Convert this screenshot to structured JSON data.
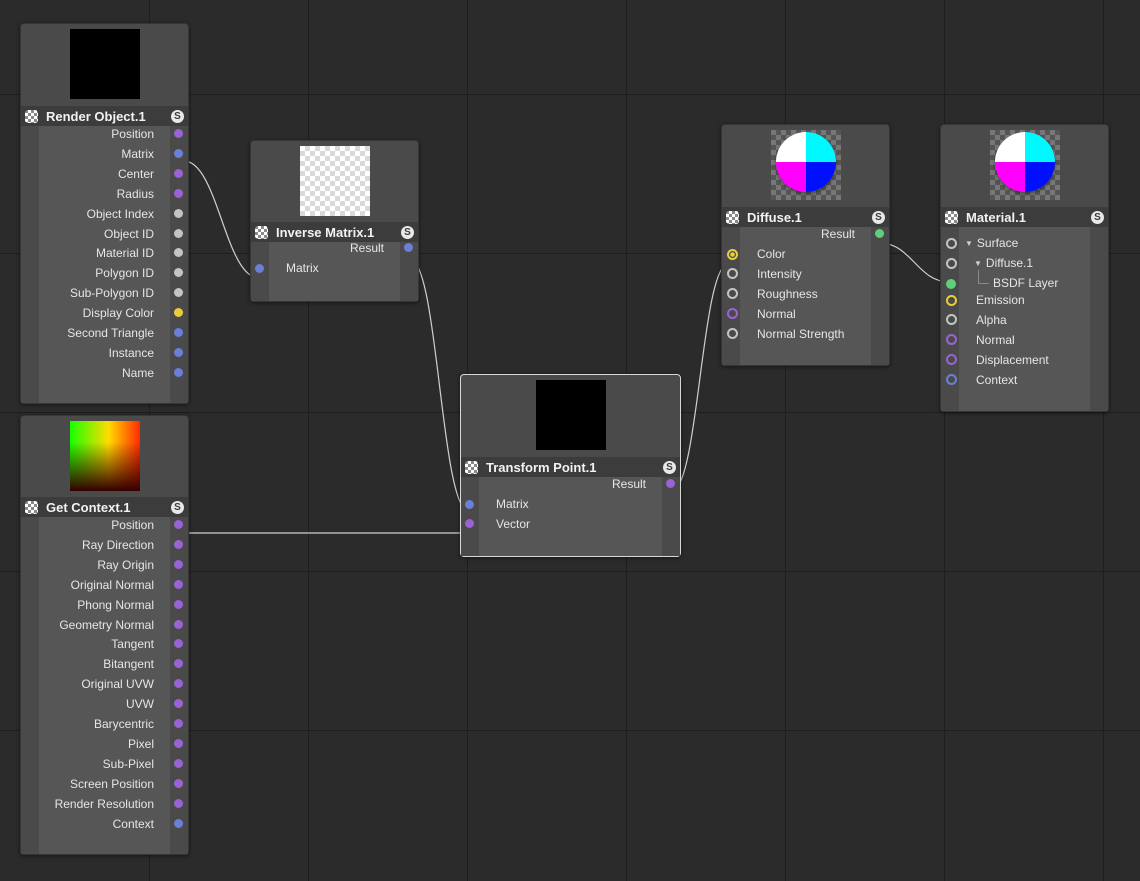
{
  "colors": {
    "purple": "#9a62d4",
    "blue": "#6a7fd8",
    "gray": "#c4c4c4",
    "yellow": "#e8cf3a",
    "green": "#5fcf7a",
    "wire": "#cfcfcf"
  },
  "nodes": {
    "render_object": {
      "title": "Render Object.1",
      "preview": "black",
      "outputs": [
        {
          "label": "Position",
          "type": "purple"
        },
        {
          "label": "Matrix",
          "type": "blue"
        },
        {
          "label": "Center",
          "type": "purple"
        },
        {
          "label": "Radius",
          "type": "purple"
        },
        {
          "label": "Object Index",
          "type": "gray"
        },
        {
          "label": "Object ID",
          "type": "gray"
        },
        {
          "label": "Material ID",
          "type": "gray"
        },
        {
          "label": "Polygon ID",
          "type": "gray"
        },
        {
          "label": "Sub-Polygon ID",
          "type": "gray"
        },
        {
          "label": "Display Color",
          "type": "yellow"
        },
        {
          "label": "Second Triangle",
          "type": "blue"
        },
        {
          "label": "Instance",
          "type": "blue"
        },
        {
          "label": "Name",
          "type": "blue"
        }
      ]
    },
    "get_context": {
      "title": "Get Context.1",
      "preview": "gradient",
      "outputs": [
        {
          "label": "Position",
          "type": "purple"
        },
        {
          "label": "Ray Direction",
          "type": "purple"
        },
        {
          "label": "Ray Origin",
          "type": "purple"
        },
        {
          "label": "Original Normal",
          "type": "purple"
        },
        {
          "label": "Phong Normal",
          "type": "purple"
        },
        {
          "label": "Geometry Normal",
          "type": "purple"
        },
        {
          "label": "Tangent",
          "type": "purple"
        },
        {
          "label": "Bitangent",
          "type": "purple"
        },
        {
          "label": "Original UVW",
          "type": "purple"
        },
        {
          "label": "UVW",
          "type": "purple"
        },
        {
          "label": "Barycentric",
          "type": "purple"
        },
        {
          "label": "Pixel",
          "type": "purple"
        },
        {
          "label": "Sub-Pixel",
          "type": "purple"
        },
        {
          "label": "Screen Position",
          "type": "purple"
        },
        {
          "label": "Render Resolution",
          "type": "purple"
        },
        {
          "label": "Context",
          "type": "blue"
        }
      ]
    },
    "inverse_matrix": {
      "title": "Inverse Matrix.1",
      "preview": "checker",
      "outputs": [
        {
          "label": "Result",
          "type": "blue"
        }
      ],
      "inputs": [
        {
          "label": "Matrix",
          "type": "blue"
        }
      ]
    },
    "transform_point": {
      "title": "Transform Point.1",
      "preview": "black",
      "outputs": [
        {
          "label": "Result",
          "type": "purple"
        }
      ],
      "inputs": [
        {
          "label": "Matrix",
          "type": "blue"
        },
        {
          "label": "Vector",
          "type": "purple"
        }
      ]
    },
    "diffuse": {
      "title": "Diffuse.1",
      "preview": "sphere",
      "outputs": [
        {
          "label": "Result",
          "type": "green"
        }
      ],
      "inputs": [
        {
          "label": "Color",
          "type": "yellow"
        },
        {
          "label": "Intensity",
          "type": "gray"
        },
        {
          "label": "Roughness",
          "type": "gray"
        },
        {
          "label": "Normal",
          "type": "purple"
        },
        {
          "label": "Normal Strength",
          "type": "gray"
        }
      ]
    },
    "material": {
      "title": "Material.1",
      "preview": "sphere",
      "tree": [
        {
          "label": "Surface",
          "expanded": true
        },
        {
          "label": "Diffuse.1",
          "expanded": true
        },
        {
          "label": "BSDF Layer"
        }
      ],
      "inputs": [
        {
          "label": "Emission",
          "type": "yellow"
        },
        {
          "label": "Alpha",
          "type": "gray"
        },
        {
          "label": "Normal",
          "type": "purple"
        },
        {
          "label": "Displacement",
          "type": "purple"
        },
        {
          "label": "Context",
          "type": "blue"
        }
      ]
    }
  }
}
